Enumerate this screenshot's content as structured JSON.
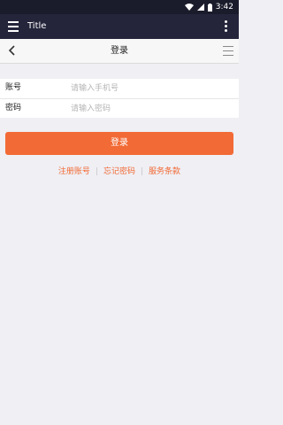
{
  "status_bar": {
    "time": "3:42"
  },
  "app_bar": {
    "title": "Title"
  },
  "nav_bar": {
    "title": "登录"
  },
  "form": {
    "account": {
      "label": "账号",
      "placeholder": "请输入手机号"
    },
    "password": {
      "label": "密码",
      "placeholder": "请输入密码"
    }
  },
  "login_button": {
    "label": "登录"
  },
  "links": {
    "register": "注册账号",
    "forgot_password": "忘记密码",
    "terms": "服务条款",
    "separator": "|"
  },
  "colors": {
    "accent": "#f26a35",
    "app_bar": "#24253b",
    "status_bar": "#1a1b2b",
    "background": "#efeff4"
  }
}
